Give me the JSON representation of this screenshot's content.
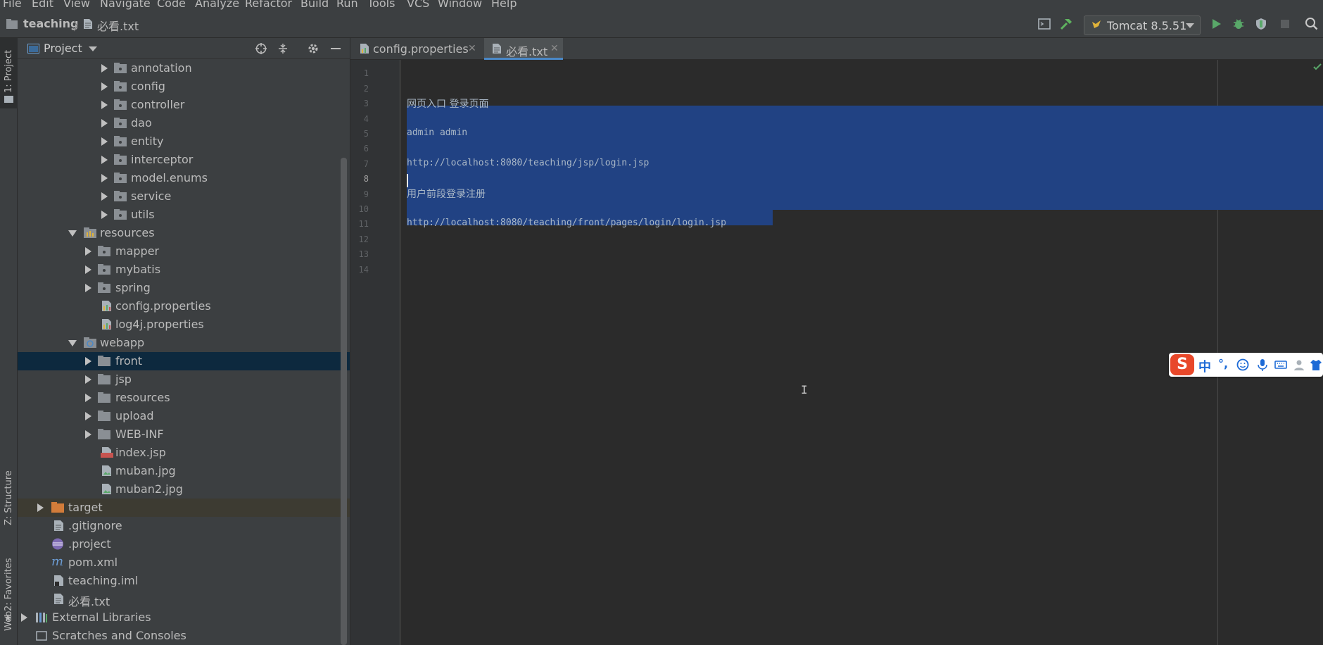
{
  "menu": [
    "File",
    "Edit",
    "View",
    "Navigate",
    "Code",
    "Analyze",
    "Refactor",
    "Build",
    "Run",
    "Tools",
    "VCS",
    "Window",
    "Help"
  ],
  "breadcrumb": {
    "project": "teaching",
    "file": "必看.txt"
  },
  "toolbar": {
    "run_config": "Tomcat 8.5.51"
  },
  "left_strip": {
    "project_tab": "1: Project",
    "structure_tab": "Z: Structure",
    "favorites_tab": "2: Favorites",
    "web_tab": "Web"
  },
  "project_panel": {
    "title": "Project",
    "tree": [
      {
        "name": "annotation"
      },
      {
        "name": "config"
      },
      {
        "name": "controller"
      },
      {
        "name": "dao"
      },
      {
        "name": "entity"
      },
      {
        "name": "interceptor"
      },
      {
        "name": "model.enums"
      },
      {
        "name": "service"
      },
      {
        "name": "utils"
      },
      {
        "name": "resources"
      },
      {
        "name": "mapper"
      },
      {
        "name": "mybatis"
      },
      {
        "name": "spring"
      },
      {
        "name": "config.properties"
      },
      {
        "name": "log4j.properties"
      },
      {
        "name": "webapp"
      },
      {
        "name": "front"
      },
      {
        "name": "jsp"
      },
      {
        "name": "resources"
      },
      {
        "name": "upload"
      },
      {
        "name": "WEB-INF"
      },
      {
        "name": "index.jsp"
      },
      {
        "name": "muban.jpg"
      },
      {
        "name": "muban2.jpg"
      },
      {
        "name": "target"
      },
      {
        "name": ".gitignore"
      },
      {
        "name": ".project"
      },
      {
        "name": "pom.xml"
      },
      {
        "name": "teaching.iml"
      },
      {
        "name": "必看.txt"
      },
      {
        "name": "External Libraries"
      },
      {
        "name": "Scratches and Consoles"
      }
    ]
  },
  "editor": {
    "tabs": [
      {
        "label": "config.properties"
      },
      {
        "label": "必看.txt",
        "active": true
      }
    ],
    "line_numbers": [
      "1",
      "2",
      "3",
      "4",
      "5",
      "6",
      "7",
      "8",
      "9",
      "10",
      "11",
      "12",
      "13",
      "14"
    ],
    "lines": [
      "",
      "",
      "网页入口 登录页面",
      "",
      "admin admin",
      "",
      "http://localhost:8080/teaching/jsp/login.jsp",
      "",
      "用户前段登录注册",
      "",
      "http://localhost:8080/teaching/front/pages/login/login.jsp",
      "",
      "",
      ""
    ]
  },
  "ime": {
    "logo": "S",
    "mode": "中",
    "punct": "°,"
  },
  "colors": {
    "selection": "#214283",
    "accent": "#4a88c7",
    "background": "#2b2b2b"
  }
}
